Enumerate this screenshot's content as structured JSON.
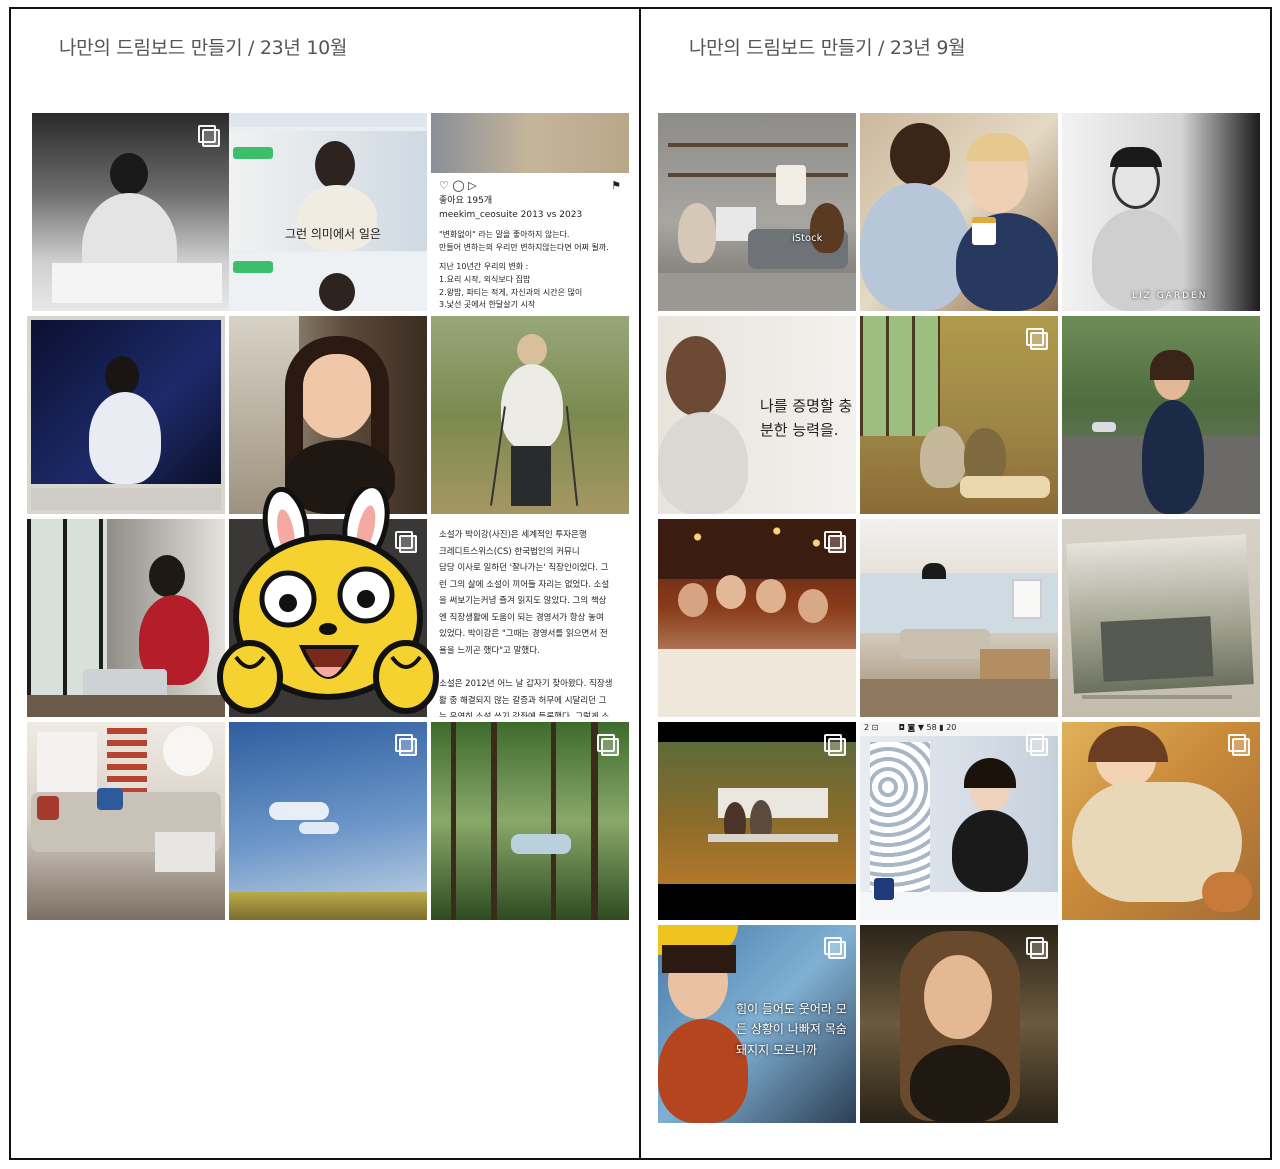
{
  "panels": {
    "left": {
      "title": "나만의 드림보드 만들기 / 23년 10월"
    },
    "right": {
      "title": "나만의 드림보드 만들기 / 23년 9월"
    }
  },
  "tiles": {
    "l_tv_caption": "그런 의미에서 일은",
    "l_post_likes": "좋아요 195개",
    "l_post_user": "meekim_ceosuite 2013 vs 2023",
    "l_post_quote": "\"변화없이\" 라는 말을 좋아하지 않는다.\n만들어 변하는의 우리만 변하지않는다면 어쩌 될까.",
    "l_post_list": "지난 10년간 우리의 변화 :\n1.요리 시작, 외식보다 집밥\n2.왕밥, 파티는 적게, 자신과의 시간은 많이\n3.낯선 곳에서 한달살기 시작",
    "l_article_text": "소설가 박이강(사진)은 세계적인 투자은행\n크레디트스위스(CS) 한국법인의 커뮤니\n담당 이사로 일하던 '잘나가는' 직장인이었다. 그\n런 그의 삶에 소설이 끼어들 자리는 없었다. 소설\n을 써보기는커녕 즐겨 읽지도 않았다. 그의 책상\n엔 직장생활에 도움이 되는 경영서가 항상 놓여\n있었다. 박이강은 \"그때는 경영서를 읽으면서 전\n율을 느끼곤 했다\"고 말했다.\n\n소설은 2012년 어느 날 갑자기 찾아왔다. 직장생\n활 중 해결되지 않는 갈증과 허무에 시달리던 그\n는 우연히 소설 쓰기 강좌에 등록했다. 그렇게 소",
    "r_istock": "iStock",
    "r_poster_caption": "나를 증명할\n충분한 능력을.",
    "r_liz": "LIZ GARDEN",
    "r_drama_caption": "힘이 들어도 웃어라\n모든 상황이 나빠져\n목숨 돼지지 모르니까",
    "r_phone_status": "2 ⊡        ◘ ◙ ▼ 58 ▮ 20"
  },
  "colors": {
    "title": "#555555",
    "border": "#111111",
    "sticker_yellow": "#F6D230",
    "sticker_ear_pink": "#F5A9A3"
  },
  "icons": {
    "multi": "multiple-images-icon",
    "sticker": "rabbit-sticker"
  }
}
